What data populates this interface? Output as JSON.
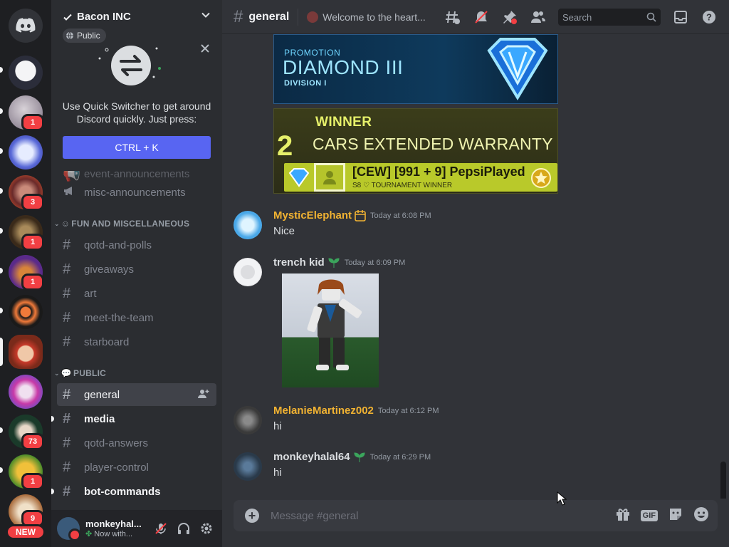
{
  "server": {
    "name": "Bacon INC",
    "visibility": "Public",
    "new_badge": "NEW",
    "rail_badges": [
      "1",
      "3",
      "1",
      "1",
      "73",
      "1",
      "9"
    ]
  },
  "quick_switcher": {
    "text": "Use Quick Switcher to get around Discord quickly. Just press:",
    "shortcut": "CTRL + K"
  },
  "channels": {
    "partial_top": "event-announcements",
    "misc": "misc-announcements",
    "cat_fun": "FUN AND MISCELLANEOUS",
    "fun": [
      "qotd-and-polls",
      "giveaways",
      "art",
      "meet-the-team",
      "starboard"
    ],
    "cat_public": "PUBLIC",
    "public": [
      "general",
      "media",
      "qotd-answers",
      "player-control",
      "bot-commands"
    ]
  },
  "user": {
    "name": "monkeyhal...",
    "status": "Now with..."
  },
  "topbar": {
    "channel": "general",
    "topic": "Welcome to the heart...",
    "search_placeholder": "Search"
  },
  "cards": {
    "promo_label": "PROMOTION",
    "rank": "DIAMOND III",
    "division": "DIVISION I",
    "winner_label": "WINNER",
    "place": "2",
    "team_name": "CARS EXTENDED WARRANTY",
    "player": "[CEW] [991 + 9] PepsiPlayed",
    "player_sub": "S8 ♡ TOURNAMENT WINNER"
  },
  "messages": [
    {
      "author": "MysticElephant",
      "time": "Today at 6:08 PM",
      "text": "Nice",
      "color": "#f0b232"
    },
    {
      "author": "trench kid",
      "time": "Today at 6:09 PM",
      "text": "",
      "color": "#dbdee1"
    },
    {
      "author": "MelanieMartinez002",
      "time": "Today at 6:12 PM",
      "text": "hi",
      "color": "#f0b232"
    },
    {
      "author": "monkeyhalal64",
      "time": "Today at 6:29 PM",
      "text": "hi",
      "color": "#dbdee1"
    }
  ],
  "composer": {
    "placeholder": "Message #general",
    "gif_label": "GIF"
  },
  "colors": {
    "accent": "#5865f2",
    "danger": "#f23f43",
    "gold_name": "#f0b232"
  }
}
